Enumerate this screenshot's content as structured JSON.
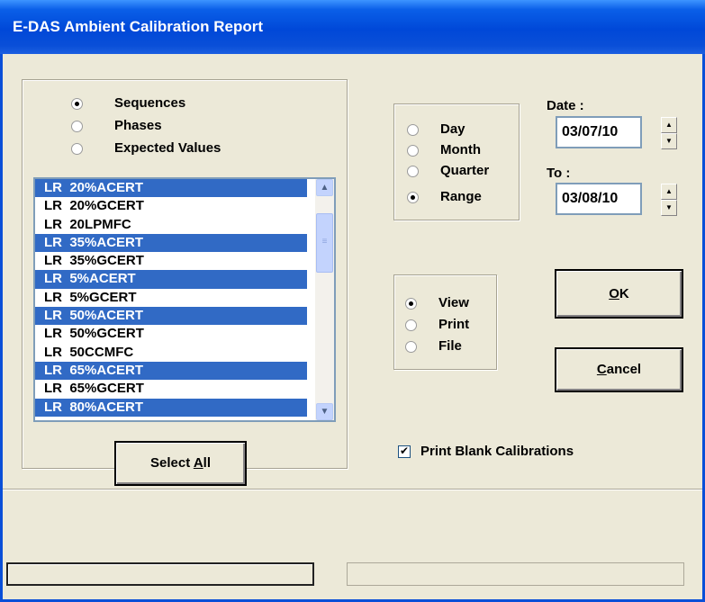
{
  "window": {
    "title": "E-DAS Ambient Calibration Report"
  },
  "selection_mode": {
    "options": [
      {
        "label": "Sequences",
        "selected": true
      },
      {
        "label": "Phases",
        "selected": false
      },
      {
        "label": "Expected Values",
        "selected": false
      }
    ]
  },
  "sequence_list": {
    "items": [
      {
        "prefix": "LR",
        "name": "20%ACERT",
        "selected": true
      },
      {
        "prefix": "LR",
        "name": "20%GCERT",
        "selected": false
      },
      {
        "prefix": "LR",
        "name": "20LPMFC",
        "selected": false
      },
      {
        "prefix": "LR",
        "name": "35%ACERT",
        "selected": true
      },
      {
        "prefix": "LR",
        "name": "35%GCERT",
        "selected": false
      },
      {
        "prefix": "LR",
        "name": "5%ACERT",
        "selected": true
      },
      {
        "prefix": "LR",
        "name": "5%GCERT",
        "selected": false
      },
      {
        "prefix": "LR",
        "name": "50%ACERT",
        "selected": true
      },
      {
        "prefix": "LR",
        "name": "50%GCERT",
        "selected": false
      },
      {
        "prefix": "LR",
        "name": "50CCMFC",
        "selected": false
      },
      {
        "prefix": "LR",
        "name": "65%ACERT",
        "selected": true
      },
      {
        "prefix": "LR",
        "name": "65%GCERT",
        "selected": false
      },
      {
        "prefix": "LR",
        "name": "80%ACERT",
        "selected": true
      }
    ]
  },
  "buttons": {
    "select_all_pre": "Select ",
    "select_all_key": "A",
    "select_all_post": "ll",
    "ok_key": "O",
    "ok_post": "K",
    "cancel_key": "C",
    "cancel_post": "ancel"
  },
  "period": {
    "options": [
      {
        "label": "Day",
        "selected": false
      },
      {
        "label": "Month",
        "selected": false
      },
      {
        "label": "Quarter",
        "selected": false
      },
      {
        "label": "Range",
        "selected": true
      }
    ]
  },
  "dates": {
    "date_label": "Date :",
    "date_value": "03/07/10",
    "to_label": "To :",
    "to_value": "03/08/10"
  },
  "output": {
    "options": [
      {
        "label": "View",
        "selected": true
      },
      {
        "label": "Print",
        "selected": false
      },
      {
        "label": "File",
        "selected": false
      }
    ]
  },
  "print_blank": {
    "label": "Print Blank Calibrations",
    "checked": true
  },
  "icons": {
    "scroll_up": "scroll-up-arrow-icon",
    "scroll_down": "scroll-down-arrow-icon",
    "spin_up": "spin-up-arrow-icon",
    "spin_down": "spin-down-arrow-icon",
    "check": "check-mark-icon"
  }
}
